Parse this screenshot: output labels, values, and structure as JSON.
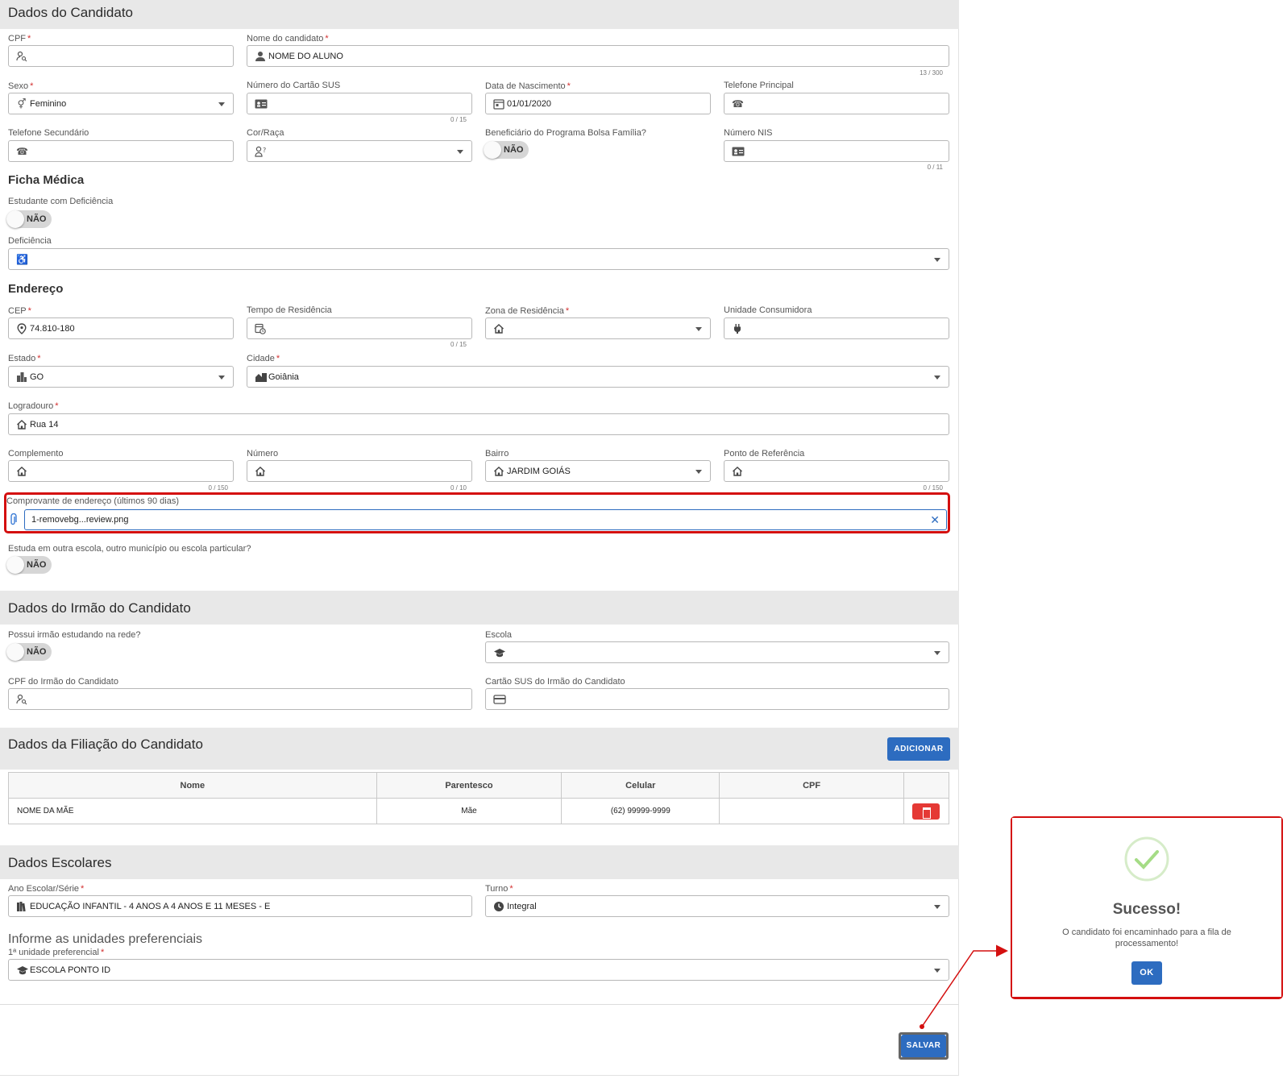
{
  "sections": {
    "candidate": "Dados do Candidato",
    "medical": "Ficha Médica",
    "address": "Endereço",
    "sibling": "Dados do Irmão do Candidato",
    "filiation": "Dados da Filiação do Candidato",
    "school": "Dados Escolares",
    "preferences": "Informe as unidades preferenciais"
  },
  "fields": {
    "cpf": {
      "label": "CPF",
      "value": ""
    },
    "nome": {
      "label": "Nome do candidato",
      "value": "NOME DO ALUNO",
      "counter": "13 / 300"
    },
    "sexo": {
      "label": "Sexo",
      "value": "Feminino"
    },
    "sus": {
      "label": "Número do Cartão SUS",
      "value": "",
      "counter": "0 / 15"
    },
    "nascimento": {
      "label": "Data de Nascimento",
      "value": "01/01/2020"
    },
    "tel_principal": {
      "label": "Telefone Principal",
      "value": ""
    },
    "tel_secundario": {
      "label": "Telefone Secundário",
      "value": ""
    },
    "cor": {
      "label": "Cor/Raça",
      "value": ""
    },
    "bolsa": {
      "label": "Beneficiário do Programa Bolsa Família?",
      "toggle": "NÃO"
    },
    "nis": {
      "label": "Número NIS",
      "value": "",
      "counter": "0 / 11"
    },
    "deficiente": {
      "label": "Estudante com Deficiência",
      "toggle": "NÃO"
    },
    "deficiencia": {
      "label": "Deficiência",
      "value": ""
    },
    "cep": {
      "label": "CEP",
      "value": "74.810-180"
    },
    "tempo": {
      "label": "Tempo de Residência",
      "value": "",
      "counter": "0 / 15"
    },
    "zona": {
      "label": "Zona de Residência",
      "value": ""
    },
    "unidade_consumidora": {
      "label": "Unidade Consumidora",
      "value": ""
    },
    "estado": {
      "label": "Estado",
      "value": "GO"
    },
    "cidade": {
      "label": "Cidade",
      "value": "Goiânia"
    },
    "logradouro": {
      "label": "Logradouro",
      "value": "Rua 14"
    },
    "complemento": {
      "label": "Complemento",
      "value": "",
      "counter": "0 / 150"
    },
    "numero": {
      "label": "Número",
      "value": "",
      "counter": "0 / 10"
    },
    "bairro": {
      "label": "Bairro",
      "value": "JARDIM GOIÁS"
    },
    "referencia": {
      "label": "Ponto de Referência",
      "value": "",
      "counter": "0 / 150"
    },
    "comprovante": {
      "label": "Comprovante de endereço (últimos 90 dias)",
      "value": "1-removebg...review.png"
    },
    "outra_escola": {
      "label": "Estuda em outra escola, outro município ou escola particular?",
      "toggle": "NÃO"
    },
    "irmao_rede": {
      "label": "Possui irmão estudando na rede?",
      "toggle": "NÃO"
    },
    "escola": {
      "label": "Escola",
      "value": ""
    },
    "cpf_irmao": {
      "label": "CPF do Irmão do Candidato",
      "value": ""
    },
    "sus_irmao": {
      "label": "Cartão SUS do Irmão do Candidato",
      "value": ""
    },
    "ano_escolar": {
      "label": "Ano Escolar/Série",
      "value": "EDUCAÇÃO INFANTIL - 4 ANOS A 4 ANOS E 11 MESES - E"
    },
    "turno": {
      "label": "Turno",
      "value": "Integral"
    },
    "unidade1": {
      "label": "1ª unidade preferencial",
      "value": "ESCOLA PONTO ID"
    }
  },
  "filiation_table": {
    "add_button": "ADICIONAR",
    "headers": [
      "Nome",
      "Parentesco",
      "Celular",
      "CPF"
    ],
    "rows": [
      {
        "nome": "NOME DA MÃE",
        "parentesco": "Mãe",
        "celular": "(62) 99999-9999",
        "cpf": ""
      }
    ]
  },
  "save_button": "SALVAR",
  "dialog": {
    "title": "Sucesso!",
    "message": "O candidato foi encaminhado para a fila de processamento!",
    "ok": "OK"
  },
  "colors": {
    "accent": "#2d6cc0",
    "danger": "#e53935",
    "highlight": "#d40f0f",
    "success": "#a5dc86"
  }
}
